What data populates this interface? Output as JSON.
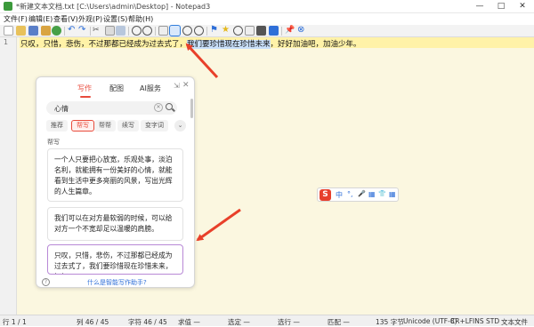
{
  "window": {
    "title": "*新建文本文档.txt [C:\\Users\\admin\\Desktop] - Notepad3",
    "controls": [
      "—",
      "□",
      "✕"
    ]
  },
  "menu": [
    "文件(F)",
    "编辑(E)",
    "查看(V)",
    "外观(P)",
    "设置(S)",
    "帮助(H)"
  ],
  "editor": {
    "line_number": "1",
    "text_before": "只叹，只惜，悲伤，不过那都已经成为过去式了，",
    "text_selected": "我们要珍惜现在珍惜未来",
    "text_after": "，好好加油吧，加油少年。"
  },
  "assistant": {
    "tabs": [
      "写作",
      "配图",
      "AI服务"
    ],
    "active_tab": "写作",
    "search_value": "心情",
    "chips": [
      "推荐",
      "帮写",
      "帮帮",
      "续写",
      "变字词"
    ],
    "active_chip": "帮写",
    "section_label": "帮写",
    "cards": [
      "一个人只要把心放宽，乐观处事，淡泊名利，就能拥有一份美好的心情，就能看到生活中更多亮丽的风景，写出光辉的人生篇章。",
      "我们可以在对方最软弱的时候，可以给对方一个不宽却足以温暖的肩膀。",
      "只叹，只惜，悲伤，不过那都已经成为过去式了，我们要珍惜现在珍惜未来，好好"
    ],
    "help_link": "什么是智能写作助手?"
  },
  "ime": {
    "logo": "S",
    "items": [
      "中",
      "°,",
      "🎤",
      "▦",
      "👕",
      "▦"
    ]
  },
  "status": {
    "line": "行 1 / 1",
    "col": "列  46 / 45",
    "char": "字符  46 / 45",
    "value": "求值  —",
    "selected": "选定  —",
    "selected_lines": "选行  —",
    "match": "匹配  —",
    "bytes": "135 字节",
    "encoding": "Unicode (UTF-8)",
    "eol": "CR+LF",
    "ins": "INS",
    "std": "STD",
    "filetype": "文本文件"
  },
  "colors": {
    "accent": "#e84b3c",
    "arrow": "#e8402a",
    "line_highlight": "#fff2a8"
  }
}
